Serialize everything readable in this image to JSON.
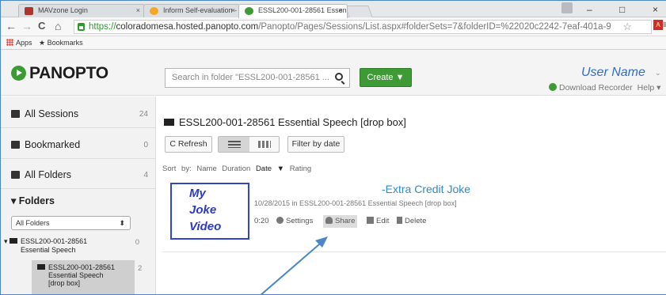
{
  "browser": {
    "tabs": [
      {
        "label": "MAVzone Login",
        "favicon_color": "#b0342c",
        "close": "×"
      },
      {
        "label": "Inform Self-evaluation - E",
        "favicon_color": "#f5a623",
        "close": "×"
      },
      {
        "label": "ESSL200-001-28561 Essen",
        "favicon_color": "#3d9a34",
        "close": "×"
      }
    ],
    "window_controls": {
      "minimize": "–",
      "maximize": "□",
      "close": "×"
    },
    "nav": {
      "back": "←",
      "forward": "→",
      "reload": "C",
      "home": "⌂"
    },
    "url": {
      "scheme": "https://",
      "host": "coloradomesa.hosted.panopto.com",
      "path": "/Panopto/Pages/Sessions/List.aspx#folderSets=7&folderID=%22020c2242-7eaf-401a-9"
    },
    "star": "☆",
    "pdf_label": "A",
    "menu": "≡",
    "bookmarks": [
      {
        "label": "Apps"
      },
      {
        "label": "Bookmarks"
      }
    ]
  },
  "header": {
    "logo": "PANOPTO",
    "search_placeholder": "Search in folder \"ESSL200-001-28561 ...",
    "create_label": "Create ▼",
    "user_name": "User Name",
    "user_caret": "⌄",
    "download_recorder": "Download Recorder",
    "help": "Help ▾"
  },
  "sidebar": {
    "items": [
      {
        "label": "All Sessions",
        "count": "24",
        "icon": "sessions-icon"
      },
      {
        "label": "Bookmarked",
        "count": "0",
        "icon": "bookmark-icon"
      },
      {
        "label": "All Folders",
        "count": "4",
        "icon": "folders-icon"
      }
    ],
    "folders_heading": "▾ Folders",
    "folder_select": "All Folders",
    "select_arrow": "⬍",
    "tree": [
      {
        "label_line1": "ESSL200-001-28561",
        "label_line2": "Essential Speech",
        "count": "0"
      },
      {
        "label_line1": "ESSL200-001-28561",
        "label_line2": "Essential Speech",
        "label_line3": "[drop box]",
        "count": "2"
      }
    ]
  },
  "main": {
    "folder_title": "ESSL200-001-28561 Essential Speech [drop box]",
    "refresh_label": "Refresh",
    "filter_label": "Filter by date",
    "sort": {
      "prefix": "Sort by:",
      "name": "Name",
      "duration": "Duration",
      "date": "Date ▼",
      "rating": "Rating"
    },
    "session": {
      "thumbnail_lines": [
        "My",
        "Joke",
        "Video"
      ],
      "title": "-Extra Credit Joke",
      "meta": "10/28/2015 in ESSL200-001-28561 Essential Speech [drop box]",
      "duration": "0:20",
      "actions": [
        "Settings",
        "Share",
        "Edit",
        "Delete"
      ]
    }
  },
  "colors": {
    "panopto_green": "#3d9a34",
    "link_blue": "#2f8ac8",
    "annotation_blue": "#2c3ac4",
    "arrow_blue": "#4a86c8"
  }
}
